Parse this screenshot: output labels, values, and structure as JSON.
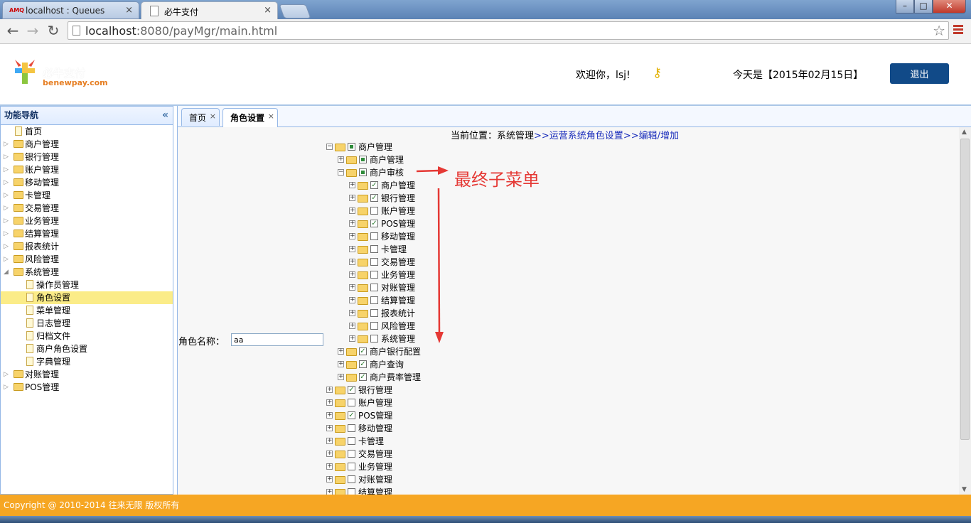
{
  "browser": {
    "tabs": [
      {
        "title": "localhost : Queues",
        "favicon": "AMQ"
      },
      {
        "title": "必牛支付"
      }
    ],
    "url_host": "localhost",
    "url_path": ":8080/payMgr/main.html"
  },
  "header": {
    "logo_name": "必牛支付",
    "logo_domain": "benewpay.com",
    "welcome": "欢迎你，lsj!",
    "change_password": "修改密码",
    "today": "今天是【2015年02月15日】",
    "logout": "退出"
  },
  "sidebar": {
    "title": "功能导航",
    "items": [
      {
        "label": "首页",
        "type": "file",
        "level": 0
      },
      {
        "label": "商户管理",
        "type": "folder",
        "level": 0
      },
      {
        "label": "银行管理",
        "type": "folder",
        "level": 0
      },
      {
        "label": "账户管理",
        "type": "folder",
        "level": 0
      },
      {
        "label": "移动管理",
        "type": "folder",
        "level": 0
      },
      {
        "label": "卡管理",
        "type": "folder",
        "level": 0
      },
      {
        "label": "交易管理",
        "type": "folder",
        "level": 0
      },
      {
        "label": "业务管理",
        "type": "folder",
        "level": 0
      },
      {
        "label": "结算管理",
        "type": "folder",
        "level": 0
      },
      {
        "label": "报表统计",
        "type": "folder",
        "level": 0
      },
      {
        "label": "风险管理",
        "type": "folder",
        "level": 0
      },
      {
        "label": "系统管理",
        "type": "folder",
        "level": 0,
        "expanded": true
      },
      {
        "label": "操作员管理",
        "type": "file",
        "level": 1
      },
      {
        "label": "角色设置",
        "type": "file",
        "level": 1,
        "selected": true
      },
      {
        "label": "菜单管理",
        "type": "file",
        "level": 1
      },
      {
        "label": "日志管理",
        "type": "file",
        "level": 1
      },
      {
        "label": "归档文件",
        "type": "file",
        "level": 1
      },
      {
        "label": "商户角色设置",
        "type": "file",
        "level": 1
      },
      {
        "label": "字典管理",
        "type": "file",
        "level": 1
      },
      {
        "label": "对账管理",
        "type": "folder",
        "level": 0
      },
      {
        "label": "POS管理",
        "type": "folder",
        "level": 0
      }
    ]
  },
  "panel_tabs": [
    {
      "label": "首页"
    },
    {
      "label": "角色设置",
      "active": true
    }
  ],
  "content": {
    "location_prefix": "当前位置：系统管理",
    "location_link1": ">>运营系统角色设置",
    "location_link2": ">>编辑/增加",
    "role_name_label": "角色名称：",
    "role_name_value": "aa",
    "annotation": "最终子菜单"
  },
  "tree": [
    {
      "label": "商户管理",
      "level": 0,
      "expanded": true,
      "check": "partial"
    },
    {
      "label": "商户管理",
      "level": 1,
      "expanded": false,
      "check": "partial"
    },
    {
      "label": "商户审核",
      "level": 1,
      "expanded": true,
      "check": "partial"
    },
    {
      "label": "商户管理",
      "level": 2,
      "expanded": false,
      "check": "checked"
    },
    {
      "label": "银行管理",
      "level": 2,
      "expanded": false,
      "check": "checked"
    },
    {
      "label": "账户管理",
      "level": 2,
      "expanded": false,
      "check": "unchecked"
    },
    {
      "label": "POS管理",
      "level": 2,
      "expanded": false,
      "check": "checked"
    },
    {
      "label": "移动管理",
      "level": 2,
      "expanded": false,
      "check": "unchecked"
    },
    {
      "label": "卡管理",
      "level": 2,
      "expanded": false,
      "check": "unchecked"
    },
    {
      "label": "交易管理",
      "level": 2,
      "expanded": false,
      "check": "unchecked"
    },
    {
      "label": "业务管理",
      "level": 2,
      "expanded": false,
      "check": "unchecked"
    },
    {
      "label": "对账管理",
      "level": 2,
      "expanded": false,
      "check": "unchecked"
    },
    {
      "label": "结算管理",
      "level": 2,
      "expanded": false,
      "check": "unchecked"
    },
    {
      "label": "报表统计",
      "level": 2,
      "expanded": false,
      "check": "unchecked"
    },
    {
      "label": "风险管理",
      "level": 2,
      "expanded": false,
      "check": "unchecked"
    },
    {
      "label": "系统管理",
      "level": 2,
      "expanded": false,
      "check": "unchecked"
    },
    {
      "label": "商户银行配置",
      "level": 1,
      "expanded": false,
      "check": "checked"
    },
    {
      "label": "商户查询",
      "level": 1,
      "expanded": false,
      "check": "checked"
    },
    {
      "label": "商户费率管理",
      "level": 1,
      "expanded": false,
      "check": "checked"
    },
    {
      "label": "银行管理",
      "level": 0,
      "expanded": false,
      "check": "checked"
    },
    {
      "label": "账户管理",
      "level": 0,
      "expanded": false,
      "check": "unchecked"
    },
    {
      "label": "POS管理",
      "level": 0,
      "expanded": false,
      "check": "checked"
    },
    {
      "label": "移动管理",
      "level": 0,
      "expanded": false,
      "check": "unchecked"
    },
    {
      "label": "卡管理",
      "level": 0,
      "expanded": false,
      "check": "unchecked"
    },
    {
      "label": "交易管理",
      "level": 0,
      "expanded": false,
      "check": "unchecked"
    },
    {
      "label": "业务管理",
      "level": 0,
      "expanded": false,
      "check": "unchecked"
    },
    {
      "label": "对账管理",
      "level": 0,
      "expanded": false,
      "check": "unchecked"
    },
    {
      "label": "结算管理",
      "level": 0,
      "expanded": false,
      "check": "unchecked"
    }
  ],
  "footer": {
    "copyright": "Copyright @ 2010-2014 往来无限    版权所有"
  },
  "colors": {
    "footer_bg": "#f6a623",
    "logout_bg": "#114a88",
    "selected_row": "#fbec88",
    "annotation": "#e53935",
    "link": "#1a2dbb"
  }
}
